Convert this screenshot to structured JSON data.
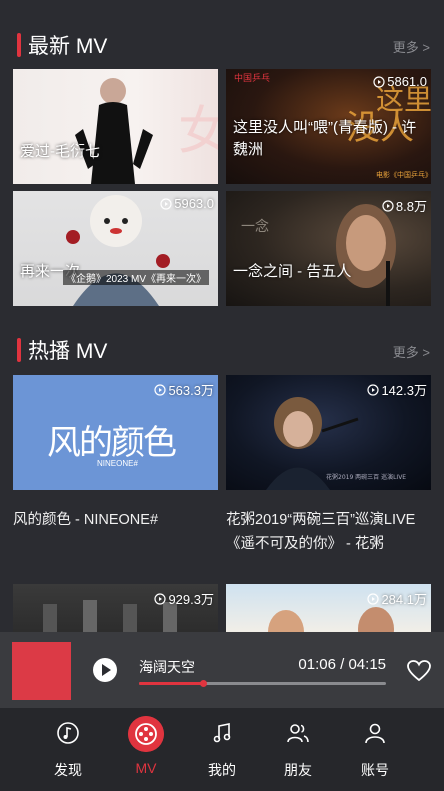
{
  "sections": {
    "latest": {
      "title": "最新 MV",
      "more": "更多 >"
    },
    "hot": {
      "title": "热播 MV",
      "more": "更多 >"
    }
  },
  "latest_mvs": [
    {
      "title": "爱过-毛衍七",
      "views": ""
    },
    {
      "title": "这里没人叫“喂”(青春版) - 许魏洲",
      "views": "5861.0"
    },
    {
      "title": "再来一次",
      "views": "5963.0",
      "caption": "《企鹅》2023 MV《再来一次》"
    },
    {
      "title": "一念之间 - 告五人",
      "views": "8.8万"
    }
  ],
  "hot_mvs": [
    {
      "title": "风的颜色 - NINEONE#",
      "views": "563.3万",
      "art_text": "风的颜色",
      "art_sub": "NINEONE#"
    },
    {
      "title": "花粥2019“两碗三百”巡演LIVE《遥不可及的你》 - 花粥",
      "views": "142.3万"
    },
    {
      "title": "",
      "views": "929.3万"
    },
    {
      "title": "",
      "views": "284.1万"
    }
  ],
  "player": {
    "song": "海阔天空",
    "time": "01:06 / 04:15",
    "progress": 0.2588
  },
  "tabs": [
    {
      "label": "发现",
      "icon": "music-note-icon"
    },
    {
      "label": "MV",
      "icon": "film-reel-icon"
    },
    {
      "label": "我的",
      "icon": "music-icon"
    },
    {
      "label": "朋友",
      "icon": "friends-icon"
    },
    {
      "label": "账号",
      "icon": "user-icon"
    }
  ],
  "colors": {
    "accent": "#e0343f",
    "background": "#2b2c31"
  }
}
